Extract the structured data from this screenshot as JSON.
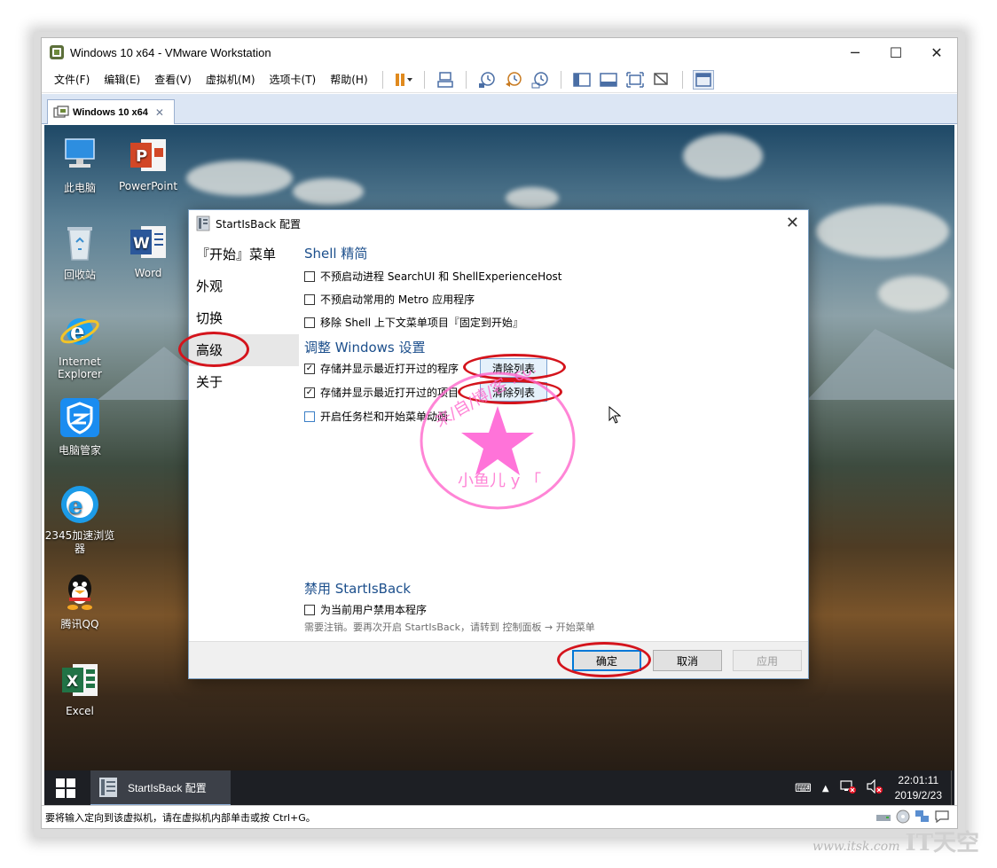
{
  "window": {
    "title": "Windows 10 x64 - VMware Workstation",
    "minimize": "─",
    "maximize": "☐",
    "close": "✕"
  },
  "menu": [
    "文件(F)",
    "编辑(E)",
    "查看(V)",
    "虚拟机(M)",
    "选项卡(T)",
    "帮助(H)"
  ],
  "tab": {
    "label": "Windows 10 x64",
    "close": "✕"
  },
  "desktop_icons": [
    {
      "label": "此电脑",
      "icon": "computer-icon"
    },
    {
      "label": "PowerPoint",
      "icon": "powerpoint-icon"
    },
    {
      "label": "回收站",
      "icon": "recycle-bin-icon"
    },
    {
      "label": "Word",
      "icon": "word-icon"
    },
    {
      "label": "Internet Explorer",
      "icon": "internet-explorer-icon"
    },
    {
      "label": "电脑管家",
      "icon": "pc-manager-icon"
    },
    {
      "label": "2345加速浏览器",
      "icon": "browser-2345-icon"
    },
    {
      "label": "腾讯QQ",
      "icon": "qq-icon"
    },
    {
      "label": "Excel",
      "icon": "excel-icon"
    }
  ],
  "dialog": {
    "title": "StartIsBack 配置",
    "nav": [
      "『开始』菜单",
      "外观",
      "切换",
      "高级",
      "关于"
    ],
    "active_nav": "高级",
    "section_shell": "Shell 精简",
    "shell_options": [
      {
        "label": "不预启动进程 SearchUI 和 ShellExperienceHost",
        "checked": false
      },
      {
        "label": "不预启动常用的 Metro 应用程序",
        "checked": false
      },
      {
        "label": "移除 Shell 上下文菜单项目『固定到开始』",
        "checked": false
      }
    ],
    "section_windows": "调整 Windows 设置",
    "windows_options": [
      {
        "label": "存储并显示最近打开过的程序",
        "checked": true,
        "check_mark": "✓"
      },
      {
        "label": "存储并显示最近打开过的项目",
        "checked": true,
        "check_mark": "✓"
      },
      {
        "label": "开启任务栏和开始菜单动画",
        "checked": false
      }
    ],
    "clear_list": "清除列表",
    "section_disable": "禁用 StartIsBack",
    "disable_option": "为当前用户禁用本程序",
    "disable_note": "需要注销。要再次开启 StartIsBack，请转到 控制面板 → 开始菜单",
    "ok": "确定",
    "cancel": "取消",
    "apply": "应用"
  },
  "stamp": {
    "arc_text": "来/自/博/客 .com",
    "name": "小鱼儿 y 「"
  },
  "taskbar": {
    "app_label": "StartIsBack 配置",
    "time": "22:01:11",
    "date": "2019/2/23"
  },
  "status": {
    "text": "要将输入定向到该虚拟机，请在虚拟机内部单击或按 Ctrl+G。"
  },
  "watermark": {
    "url": "www.itsk.com",
    "brand": "IT天空"
  },
  "colors": {
    "accent": "#0078d7",
    "annotation": "#d4141c",
    "stamp": "#ff66cc",
    "section": "#1c4f8c"
  }
}
